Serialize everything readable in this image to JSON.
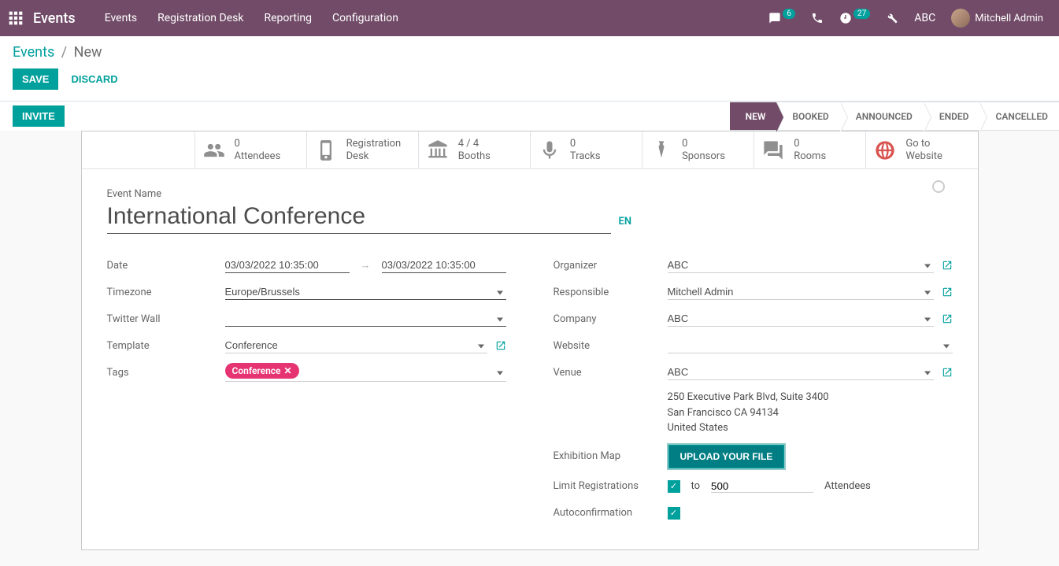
{
  "topbar": {
    "module": "Events",
    "nav": [
      "Events",
      "Registration Desk",
      "Reporting",
      "Configuration"
    ],
    "chat_badge": "6",
    "activity_badge": "27",
    "company": "ABC",
    "user": "Mitchell Admin"
  },
  "breadcrumb": {
    "root": "Events",
    "current": "New"
  },
  "buttons": {
    "save": "SAVE",
    "discard": "DISCARD",
    "invite": "INVITE"
  },
  "stages": [
    "NEW",
    "BOOKED",
    "ANNOUNCED",
    "ENDED",
    "CANCELLED"
  ],
  "active_stage": "NEW",
  "stats": {
    "attendees": {
      "n": "0",
      "label": "Attendees"
    },
    "regdesk": {
      "n": "",
      "l1": "Registration",
      "l2": "Desk"
    },
    "booths": {
      "n": "4 / 4",
      "label": "Booths"
    },
    "tracks": {
      "n": "0",
      "label": "Tracks"
    },
    "sponsors": {
      "n": "0",
      "label": "Sponsors"
    },
    "rooms": {
      "n": "0",
      "label": "Rooms"
    },
    "website": {
      "l1": "Go to",
      "l2": "Website"
    }
  },
  "form": {
    "name_label": "Event Name",
    "name": "International Conference",
    "lang": "EN",
    "labels": {
      "date": "Date",
      "timezone": "Timezone",
      "twitter": "Twitter Wall",
      "template": "Template",
      "tags": "Tags",
      "organizer": "Organizer",
      "responsible": "Responsible",
      "company": "Company",
      "website": "Website",
      "venue": "Venue",
      "exmap": "Exhibition Map",
      "limit": "Limit Registrations",
      "autoconf": "Autoconfirmation"
    },
    "date_start": "03/03/2022 10:35:00",
    "date_end": "03/03/2022 10:35:00",
    "timezone": "Europe/Brussels",
    "twitter": "",
    "template": "Conference",
    "tag": "Conference",
    "organizer": "ABC",
    "responsible": "Mitchell Admin",
    "company": "ABC",
    "website": "",
    "venue": "ABC",
    "addr1": "250 Executive Park Blvd, Suite 3400",
    "addr2": "San Francisco CA 94134",
    "addr3": "United States",
    "upload": "UPLOAD YOUR FILE",
    "limit_to": "to",
    "limit_val": "500",
    "limit_unit": "Attendees"
  }
}
